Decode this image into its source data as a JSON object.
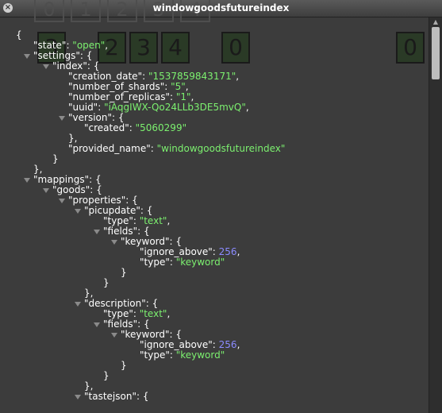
{
  "window": {
    "title": "windowgoodsfutureindex",
    "close_icon": "×"
  },
  "ghost_keys": [
    "0",
    "1",
    "2",
    "3",
    "4"
  ],
  "overlay": {
    "digits": [
      "3",
      "2",
      "3",
      "4",
      "0",
      "0"
    ]
  },
  "lines": [
    {
      "indent": 0,
      "arrow": false,
      "parts": [
        {
          "t": "{"
        }
      ]
    },
    {
      "indent": 1,
      "arrow": false,
      "parts": [
        {
          "t": "\"state\": "
        },
        {
          "t": "\"open\"",
          "c": "str"
        },
        {
          "t": ","
        }
      ]
    },
    {
      "indent": 1,
      "arrow": true,
      "parts": [
        {
          "t": "\"settings\": {"
        }
      ]
    },
    {
      "indent": 2,
      "arrow": true,
      "parts": [
        {
          "t": "\"index\": {"
        }
      ]
    },
    {
      "indent": 3,
      "arrow": false,
      "parts": [
        {
          "t": "\"creation_date\": "
        },
        {
          "t": "\"1537859843171\"",
          "c": "str"
        },
        {
          "t": ","
        }
      ]
    },
    {
      "indent": 3,
      "arrow": false,
      "parts": [
        {
          "t": "\"number_of_shards\": "
        },
        {
          "t": "\"5\"",
          "c": "str"
        },
        {
          "t": ","
        }
      ]
    },
    {
      "indent": 3,
      "arrow": false,
      "parts": [
        {
          "t": "\"number_of_replicas\": "
        },
        {
          "t": "\"1\"",
          "c": "str"
        },
        {
          "t": ","
        }
      ]
    },
    {
      "indent": 3,
      "arrow": false,
      "parts": [
        {
          "t": "\"uuid\": "
        },
        {
          "t": "\"iAqgIWX-Qo24LLb3DE5mvQ\"",
          "c": "str"
        },
        {
          "t": ","
        }
      ]
    },
    {
      "indent": 3,
      "arrow": true,
      "parts": [
        {
          "t": "\"version\": {"
        }
      ]
    },
    {
      "indent": 4,
      "arrow": false,
      "parts": [
        {
          "t": "\"created\": "
        },
        {
          "t": "\"5060299\"",
          "c": "str"
        }
      ]
    },
    {
      "indent": 3,
      "arrow": false,
      "parts": [
        {
          "t": "},"
        }
      ]
    },
    {
      "indent": 3,
      "arrow": false,
      "parts": [
        {
          "t": "\"provided_name\": "
        },
        {
          "t": "\"windowgoodsfutureindex\"",
          "c": "str"
        }
      ]
    },
    {
      "indent": 2,
      "arrow": false,
      "parts": [
        {
          "t": "}"
        }
      ]
    },
    {
      "indent": 1,
      "arrow": false,
      "parts": [
        {
          "t": "},"
        }
      ]
    },
    {
      "indent": 1,
      "arrow": true,
      "parts": [
        {
          "t": "\"mappings\": {"
        }
      ]
    },
    {
      "indent": 2,
      "arrow": true,
      "parts": [
        {
          "t": "\"goods\": {"
        }
      ]
    },
    {
      "indent": 3,
      "arrow": true,
      "parts": [
        {
          "t": "\"properties\": {"
        }
      ]
    },
    {
      "indent": 4,
      "arrow": true,
      "parts": [
        {
          "t": "\"picupdate\": {"
        }
      ]
    },
    {
      "indent": 5,
      "arrow": false,
      "parts": [
        {
          "t": "\"type\": "
        },
        {
          "t": "\"text\"",
          "c": "str"
        },
        {
          "t": ","
        }
      ]
    },
    {
      "indent": 5,
      "arrow": true,
      "parts": [
        {
          "t": "\"fields\": {"
        }
      ]
    },
    {
      "indent": 6,
      "arrow": true,
      "parts": [
        {
          "t": "\"keyword\": {"
        }
      ]
    },
    {
      "indent": 7,
      "arrow": false,
      "parts": [
        {
          "t": "\"ignore_above\": "
        },
        {
          "t": "256",
          "c": "num"
        },
        {
          "t": ","
        }
      ]
    },
    {
      "indent": 7,
      "arrow": false,
      "parts": [
        {
          "t": "\"type\": "
        },
        {
          "t": "\"keyword\"",
          "c": "str"
        }
      ]
    },
    {
      "indent": 6,
      "arrow": false,
      "parts": [
        {
          "t": "}"
        }
      ]
    },
    {
      "indent": 5,
      "arrow": false,
      "parts": [
        {
          "t": "}"
        }
      ]
    },
    {
      "indent": 4,
      "arrow": false,
      "parts": [
        {
          "t": "},"
        }
      ]
    },
    {
      "indent": 4,
      "arrow": true,
      "parts": [
        {
          "t": "\"description\": {"
        }
      ]
    },
    {
      "indent": 5,
      "arrow": false,
      "parts": [
        {
          "t": "\"type\": "
        },
        {
          "t": "\"text\"",
          "c": "str"
        },
        {
          "t": ","
        }
      ]
    },
    {
      "indent": 5,
      "arrow": true,
      "parts": [
        {
          "t": "\"fields\": {"
        }
      ]
    },
    {
      "indent": 6,
      "arrow": true,
      "parts": [
        {
          "t": "\"keyword\": {"
        }
      ]
    },
    {
      "indent": 7,
      "arrow": false,
      "parts": [
        {
          "t": "\"ignore_above\": "
        },
        {
          "t": "256",
          "c": "num"
        },
        {
          "t": ","
        }
      ]
    },
    {
      "indent": 7,
      "arrow": false,
      "parts": [
        {
          "t": "\"type\": "
        },
        {
          "t": "\"keyword\"",
          "c": "str"
        }
      ]
    },
    {
      "indent": 6,
      "arrow": false,
      "parts": [
        {
          "t": "}"
        }
      ]
    },
    {
      "indent": 5,
      "arrow": false,
      "parts": [
        {
          "t": "}"
        }
      ]
    },
    {
      "indent": 4,
      "arrow": false,
      "parts": [
        {
          "t": "},"
        }
      ]
    },
    {
      "indent": 4,
      "arrow": true,
      "parts": [
        {
          "t": "\"tastejson\": {"
        }
      ]
    }
  ],
  "colors": {
    "string": "#7cf06f",
    "number": "#8b8bff",
    "text": "#ffffff",
    "background": "#3c3c3c"
  }
}
